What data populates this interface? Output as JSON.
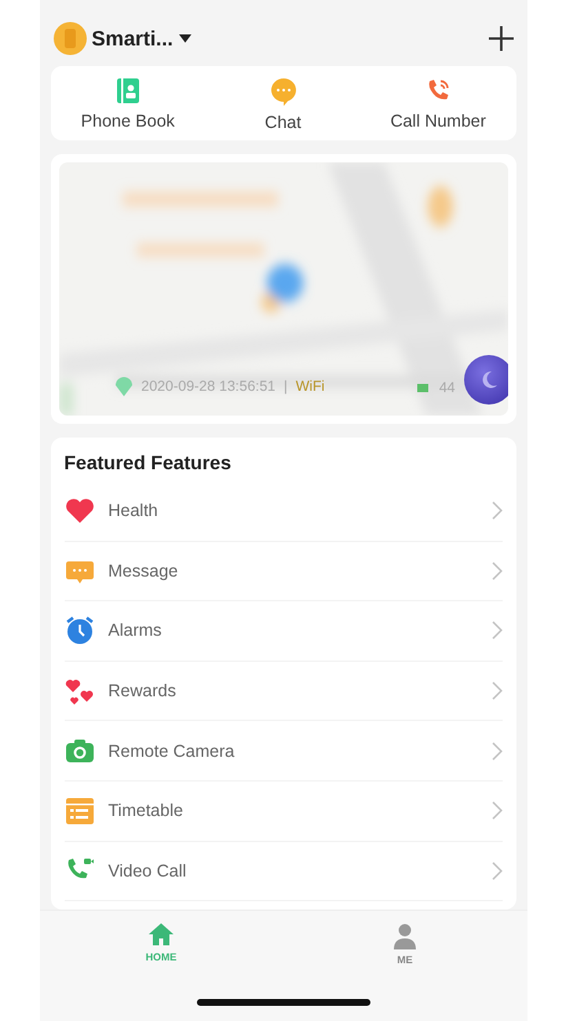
{
  "header": {
    "device_name": "Smarti..."
  },
  "quick_actions": [
    {
      "kind": "phonebook",
      "label": "Phone Book"
    },
    {
      "kind": "chat",
      "label": "Chat"
    },
    {
      "kind": "call",
      "label": "Call Number"
    }
  ],
  "map": {
    "kind": "picture",
    "timestamp": "2020-09-28 13:56:51",
    "separator": "|",
    "network": "WiFi",
    "battery": "44"
  },
  "features": {
    "title": "Featured Features",
    "items": [
      {
        "kind": "health",
        "label": "Health"
      },
      {
        "kind": "message",
        "label": "Message"
      },
      {
        "kind": "alarm",
        "label": "Alarms"
      },
      {
        "kind": "rewards",
        "label": "Rewards"
      },
      {
        "kind": "camera",
        "label": "Remote Camera"
      },
      {
        "kind": "timetable",
        "label": "Timetable"
      },
      {
        "kind": "videocall",
        "label": "Video Call"
      }
    ]
  },
  "tabs": [
    {
      "kind": "home",
      "label": "HOME",
      "selected": true
    },
    {
      "kind": "me",
      "label": "ME",
      "selected": false
    }
  ]
}
